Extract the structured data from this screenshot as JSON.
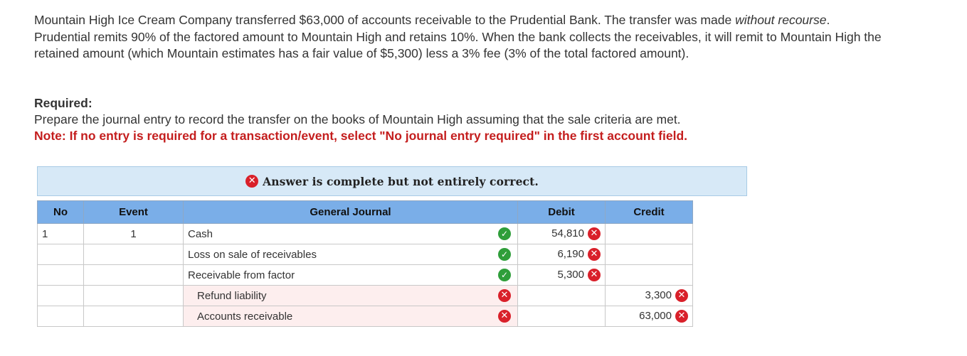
{
  "problem": {
    "part1": "Mountain High Ice Cream Company transferred $63,000 of accounts receivable to the Prudential Bank. The transfer was made ",
    "italic1": "without recourse",
    "part2": ". Prudential remits 90% of the factored amount to Mountain High and retains 10%. When the bank collects the receivables, it will remit to Mountain High the retained amount (which Mountain estimates has a fair value of $5,300) less a 3% fee (3% of the total factored amount)."
  },
  "required": {
    "heading": "Required:",
    "instruction": "Prepare the journal entry to record the transfer on the books of Mountain High assuming that the sale criteria are met.",
    "note": "Note: If no entry is required for a transaction/event, select \"No journal entry required\" in the first account field."
  },
  "banner": {
    "text": "Answer is complete but not entirely correct.",
    "icon": "x-circle-icon"
  },
  "table": {
    "headers": [
      "No",
      "Event",
      "General Journal",
      "Debit",
      "Credit"
    ],
    "rows": [
      {
        "no": "1",
        "event": "1",
        "account": "Cash",
        "status": "correct",
        "debit": "54,810",
        "debit_status": "incorrect",
        "credit": "",
        "credit_status": ""
      },
      {
        "no": "",
        "event": "",
        "account": "Loss on sale of receivables",
        "status": "correct",
        "debit": "6,190",
        "debit_status": "incorrect",
        "credit": "",
        "credit_status": ""
      },
      {
        "no": "",
        "event": "",
        "account": "Receivable from factor",
        "status": "correct",
        "debit": "5,300",
        "debit_status": "incorrect",
        "credit": "",
        "credit_status": ""
      },
      {
        "no": "",
        "event": "",
        "account": "Refund liability",
        "status": "incorrect",
        "debit": "",
        "debit_status": "",
        "credit": "3,300",
        "credit_status": "incorrect"
      },
      {
        "no": "",
        "event": "",
        "account": "Accounts receivable",
        "status": "incorrect",
        "debit": "",
        "debit_status": "",
        "credit": "63,000",
        "credit_status": "incorrect"
      }
    ]
  },
  "icons": {
    "correct_symbol": "✓",
    "incorrect_symbol": "✕"
  },
  "colors": {
    "incorrect": "#d9202a",
    "correct": "#2f9e3a",
    "header_bg": "#7aaee8",
    "banner_bg": "#d7e9f7",
    "note_red": "#c41e1e"
  }
}
